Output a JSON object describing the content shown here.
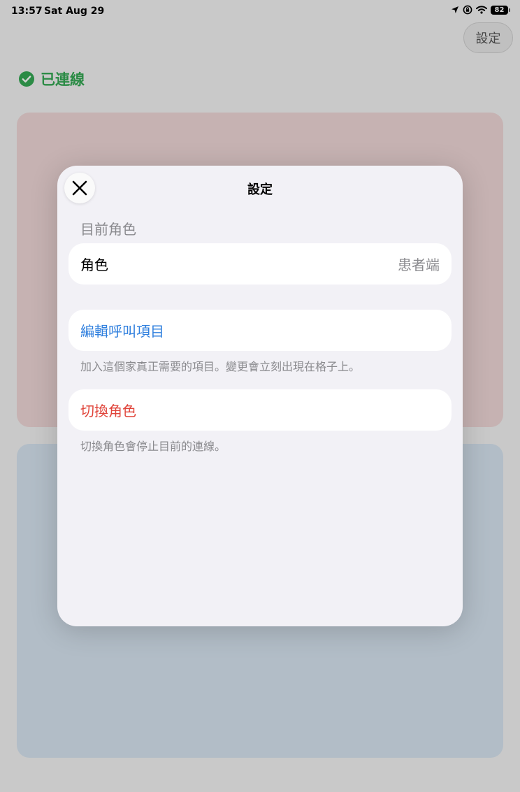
{
  "status_bar": {
    "time": "13:57",
    "date": "Sat Aug 29",
    "battery": "82",
    "icons": [
      "location-arrow-icon",
      "screen-lock-rotation-icon",
      "wifi-icon",
      "battery-icon"
    ]
  },
  "header": {
    "settings_label": "設定"
  },
  "connection": {
    "status": "已連線",
    "icon": "checkmark-circle-icon",
    "color": "#34a853"
  },
  "cards": {
    "top_color": "#eed6d6",
    "bottom_color": "#d7e4f0"
  },
  "sheet": {
    "title": "設定",
    "close_icon": "close-icon",
    "section_header": "目前角色",
    "role_row": {
      "label": "角色",
      "value": "患者端"
    },
    "edit_row": {
      "label": "編輯呼叫項目",
      "color": "#2f7fde"
    },
    "edit_footnote": "加入這個家真正需要的項目。變更會立刻出現在格子上。",
    "switch_row": {
      "label": "切換角色",
      "color": "#e0443a"
    },
    "switch_footnote": "切換角色會停止目前的連線。"
  }
}
